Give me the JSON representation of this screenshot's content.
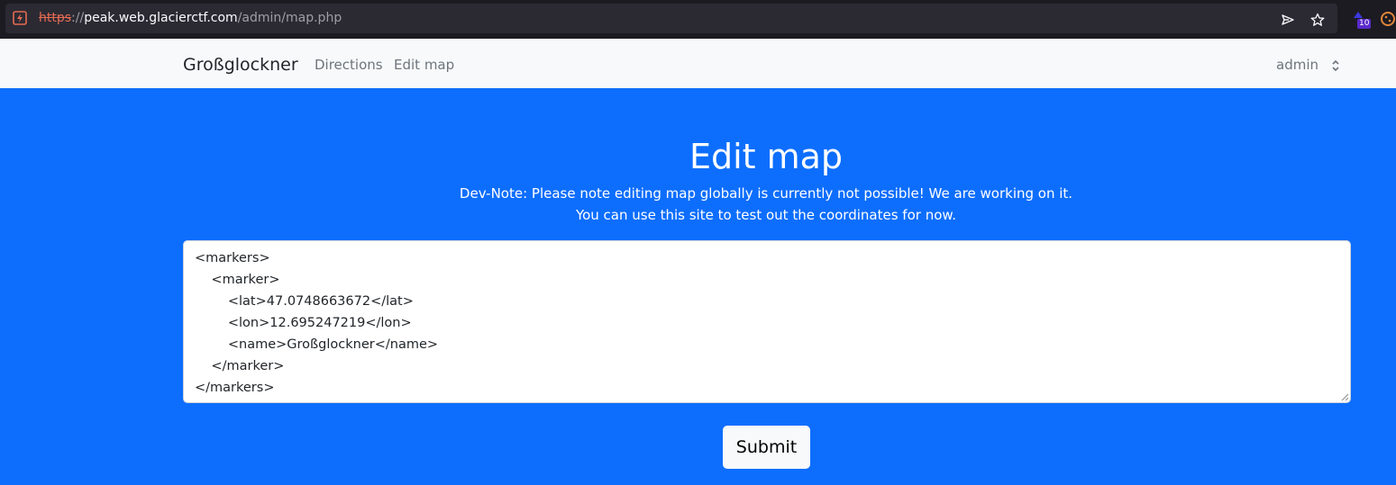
{
  "browser": {
    "url_scheme": "https",
    "url_sep": "://",
    "url_host": "peak.web.glacierctf.com",
    "url_path": "/admin/map.php",
    "extension_badge": "10"
  },
  "navbar": {
    "brand": "Großglockner",
    "links": [
      "Directions",
      "Edit map"
    ],
    "user": "admin"
  },
  "main": {
    "title": "Edit map",
    "note_line1": "Dev-Note: Please note editing map globally is currently not possible! We are working on it.",
    "note_line2": "You can use this site to test out the coordinates for now.",
    "editor_lines": [
      "<markers>",
      "    <marker>",
      "        <lat>47.0748663672</lat>",
      "        <lon>12.695247219</lon>",
      "        <name>Großglockner</name>",
      "    </marker>",
      "</markers>"
    ],
    "submit_label": "Submit"
  },
  "colors": {
    "primary": "#0d6efd",
    "navbar_bg": "#f8f9fa",
    "browser_bg": "#1c1b22"
  }
}
